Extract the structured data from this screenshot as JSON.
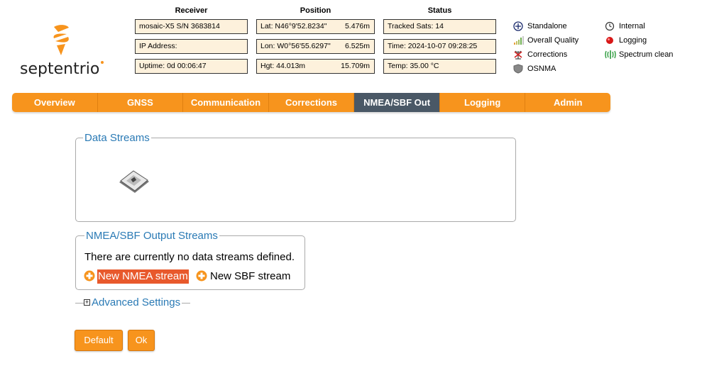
{
  "logo": {
    "text": "septentrio"
  },
  "header": {
    "receiver": {
      "title": "Receiver",
      "model": "mosaic-X5 S/N 3683814",
      "ip": "IP Address:",
      "uptime": "Uptime: 0d 00:06:47"
    },
    "position": {
      "title": "Position",
      "lat": "Lat:  N46°9'52.8234\"",
      "lat_err": "5.476m",
      "lon": "Lon: W0°56'55.6297\"",
      "lon_err": "6.525m",
      "hgt": "Hgt:  44.013m",
      "hgt_err": "15.709m"
    },
    "status": {
      "title": "Status",
      "sats": "Tracked Sats: 14",
      "time": "Time: 2024-10-07 09:28:25",
      "temp": "Temp: 35.00 °C"
    }
  },
  "legend": {
    "standalone": "Standalone",
    "quality": "Overall Quality",
    "corrections": "Corrections",
    "osnma": "OSNMA",
    "internal": "Internal",
    "logging": "Logging",
    "spectrum": "Spectrum clean"
  },
  "nav": [
    {
      "label": "Overview"
    },
    {
      "label": "GNSS"
    },
    {
      "label": "Communication"
    },
    {
      "label": "Corrections"
    },
    {
      "label": "NMEA/SBF Out",
      "active": true
    },
    {
      "label": "Logging"
    },
    {
      "label": "Admin"
    }
  ],
  "data_streams": {
    "legend": "Data Streams"
  },
  "output_streams": {
    "legend": "NMEA/SBF Output Streams",
    "empty_text": "There are currently no data streams defined.",
    "new_nmea": "New NMEA stream",
    "new_sbf": "New SBF stream"
  },
  "advanced": {
    "label": "Advanced Settings"
  },
  "buttons": {
    "default": "Default",
    "ok": "Ok"
  },
  "colors": {
    "accent": "#f7941d",
    "active_tab": "#4a5866",
    "link": "#2a7ab5",
    "highlight": "#e8592c"
  }
}
